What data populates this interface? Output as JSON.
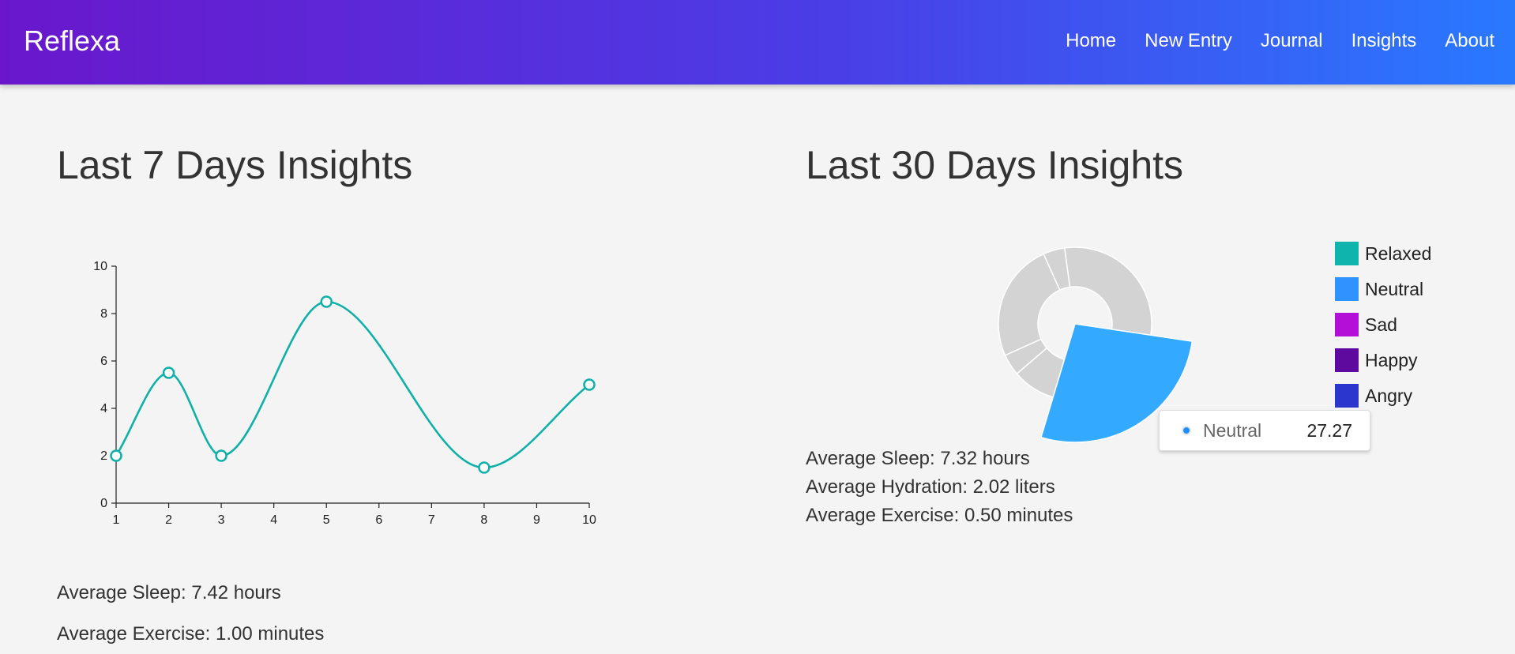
{
  "nav": {
    "brand": "Reflexa",
    "links": [
      "Home",
      "New Entry",
      "Journal",
      "Insights",
      "About"
    ]
  },
  "week": {
    "title": "Last 7 Days Insights",
    "avg_sleep": "Average Sleep: 7.42 hours",
    "avg_exercise": "Average Exercise: 1.00 minutes"
  },
  "month": {
    "title": "Last 30 Days Insights",
    "avg_sleep": "Average Sleep: 7.32 hours",
    "avg_hydration": "Average Hydration: 2.02 liters",
    "avg_exercise": "Average Exercise: 0.50 minutes",
    "tooltip": {
      "label": "Neutral",
      "value": "27.27",
      "dot_color": "#1f8fff"
    }
  },
  "chart_data": [
    {
      "type": "line",
      "smooth": true,
      "color": "#0fb0a8",
      "x": [
        1,
        2,
        3,
        5,
        8,
        10
      ],
      "y": [
        2,
        5.5,
        2,
        8.5,
        1.5,
        5
      ],
      "xlim": [
        1,
        10
      ],
      "ylim": [
        0,
        10
      ],
      "xticks": [
        1,
        2,
        3,
        4,
        5,
        6,
        7,
        8,
        9,
        10
      ],
      "yticks": [
        0,
        2,
        4,
        6,
        8,
        10
      ],
      "title": "",
      "xlabel": "",
      "ylabel": ""
    },
    {
      "type": "pie",
      "donut": true,
      "highlighted": "Neutral",
      "legend_position": "right",
      "labels": [
        "Relaxed",
        "Neutral",
        "Sad",
        "Happy",
        "Angry"
      ],
      "colors": [
        "#0fb5ad",
        "#2f93ff",
        "#b40fd6",
        "#5e0a9e",
        "#2a36cc"
      ],
      "slices": [
        {
          "label": "Neutral",
          "value": 27.27,
          "color": "#33aaff"
        },
        {
          "label": "",
          "value": 9.09,
          "color": "#d3d3d3"
        },
        {
          "label": "",
          "value": 4.55,
          "color": "#d3d3d3"
        },
        {
          "label": "",
          "value": 25,
          "color": "#d3d3d3"
        },
        {
          "label": "",
          "value": 4.55,
          "color": "#d3d3d3"
        },
        {
          "label": "",
          "value": 29.54,
          "color": "#d3d3d3"
        }
      ]
    }
  ]
}
